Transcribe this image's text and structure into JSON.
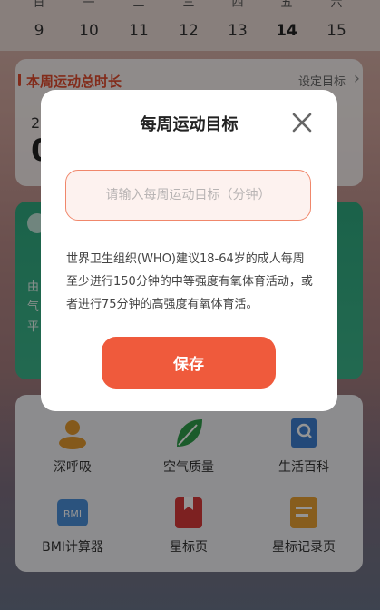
{
  "calendar": {
    "weekdays": [
      "日",
      "一",
      "二",
      "三",
      "四",
      "五",
      "六"
    ],
    "dates": [
      "9",
      "10",
      "11",
      "12",
      "13",
      "14",
      "15"
    ]
  },
  "summary": {
    "title": "本周运动总时长",
    "set_goal_label": "设定目标",
    "arrow": "›",
    "small_value": "2",
    "big_value": "0"
  },
  "green_card": {
    "lines": [
      "由",
      "气",
      "平"
    ]
  },
  "tools": [
    {
      "label": "深呼吸",
      "icon": "breathing-icon",
      "color": "#e39a2f"
    },
    {
      "label": "空气质量",
      "icon": "leaf-icon",
      "color": "#2f9e4b"
    },
    {
      "label": "生活百科",
      "icon": "book-search-icon",
      "color": "#3d7fd1"
    },
    {
      "label": "BMI计算器",
      "icon": "bmi-icon",
      "color": "#4a8fd9"
    },
    {
      "label": "星标页",
      "icon": "bookmark-icon",
      "color": "#d83a3a"
    },
    {
      "label": "星标记录页",
      "icon": "notes-icon",
      "color": "#e8a032"
    }
  ],
  "dialog": {
    "title": "每周运动目标",
    "input_value": "",
    "input_placeholder": "请输入每周运动目标（分钟）",
    "advice": "世界卫生组织(WHO)建议18-64岁的成人每周至少进行150分钟的中等强度有氧体育活动，或者进行75分钟的高强度有氧体育活。",
    "save_label": "保存",
    "accent_color": "#ef5a3c"
  }
}
